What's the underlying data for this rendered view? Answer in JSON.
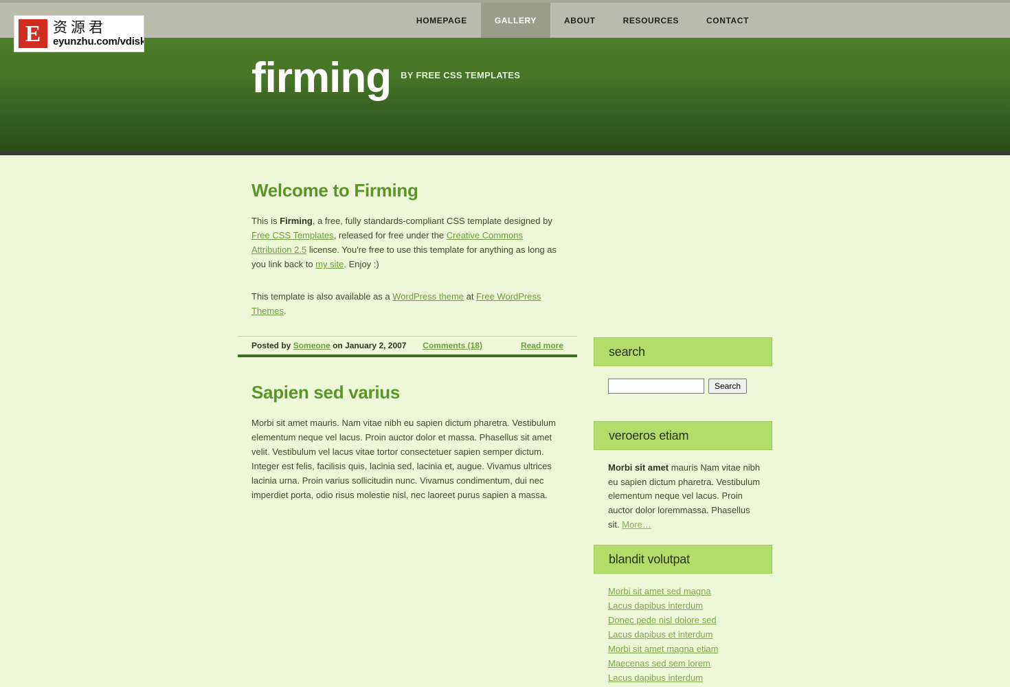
{
  "logo": {
    "mark_letter": "E",
    "chinese": "资源君",
    "url": "eyunzhu.com/vdisk"
  },
  "nav": {
    "items": [
      {
        "label": "HOMEPAGE",
        "active": false
      },
      {
        "label": "GALLERY",
        "active": true
      },
      {
        "label": "ABOUT",
        "active": false
      },
      {
        "label": "RESOURCES",
        "active": false
      },
      {
        "label": "CONTACT",
        "active": false
      }
    ]
  },
  "banner": {
    "title": "firming",
    "subtitle": "BY FREE CSS TEMPLATES"
  },
  "posts": [
    {
      "title": "Welcome to Firming",
      "p1": {
        "t1": "This is ",
        "b1": "Firming",
        "t2": ", a free, fully standards-compliant CSS template designed by ",
        "a1": "Free CSS Templates",
        "t3": ", released for free under the ",
        "a2": "Creative Commons Attribution 2.5",
        "t4": " license. You're free to use this template for anything as long as you link back to ",
        "a3": "my site",
        "t5": ". Enjoy :)"
      },
      "p2": {
        "t1": "This template is also available as a ",
        "a1": "WordPress theme",
        "t2": " at ",
        "a2": "Free WordPress Themes",
        "t3": "."
      },
      "meta": {
        "posted_by_prefix": "Posted by",
        "author": "Someone",
        "date_prefix": "on",
        "date": "January 2, 2007",
        "comments": "Comments (18)",
        "read_more": "Read more"
      }
    },
    {
      "title": "Sapien sed varius",
      "body": "Morbi sit amet mauris. Nam vitae nibh eu sapien dictum pharetra. Vestibulum elementum neque vel lacus. Proin auctor dolor et massa. Phasellus sit amet velit. Vestibulum vel lacus vitae tortor consectetuer sapien semper dictum. Integer est felis, facilisis quis, lacinia sed, lacinia et, augue. Vivamus ultrices lacinia urna. Proin varius sollicitudin nunc. Vivamus condimentum, dui nec imperdiet porta, odio risus molestie nisl, nec laoreet purus sapien a massa."
    }
  ],
  "sidebar": {
    "search": {
      "heading": "search",
      "input_value": "",
      "placeholder": "",
      "button_label": "Search"
    },
    "veroeros": {
      "heading": "veroeros etiam",
      "bold_lead": "Morbi sit amet",
      "text": " mauris Nam vitae nibh eu sapien dictum pharetra. Vestibulum elementum neque vel lacus. Proin auctor dolor loremmassa. Phasellus sit. ",
      "more_label": "More…"
    },
    "blandit": {
      "heading": "blandit volutpat",
      "links": [
        "Morbi sit amet sed magna",
        "Lacus dapibus interdum",
        "Donec pede nisl dolore sed",
        "Lacus dapibus et interdum",
        "Morbi sit amet magna etiam",
        "Maecenas sed sem lorem",
        "Lacus dapibus interdum"
      ]
    }
  },
  "colors": {
    "navbar": "#b9bcab",
    "nav_active": "#9a9d88",
    "banner_top": "#4e7e2c",
    "banner_bottom": "#2b4e19",
    "banner_rule": "#383d33",
    "page_bg": "#eef8d8",
    "heading_green": "#5a9527",
    "sidebar_head_bg": "#b3dd6a",
    "link_green": "#6a9e3d",
    "logo_red": "#d22b20"
  }
}
